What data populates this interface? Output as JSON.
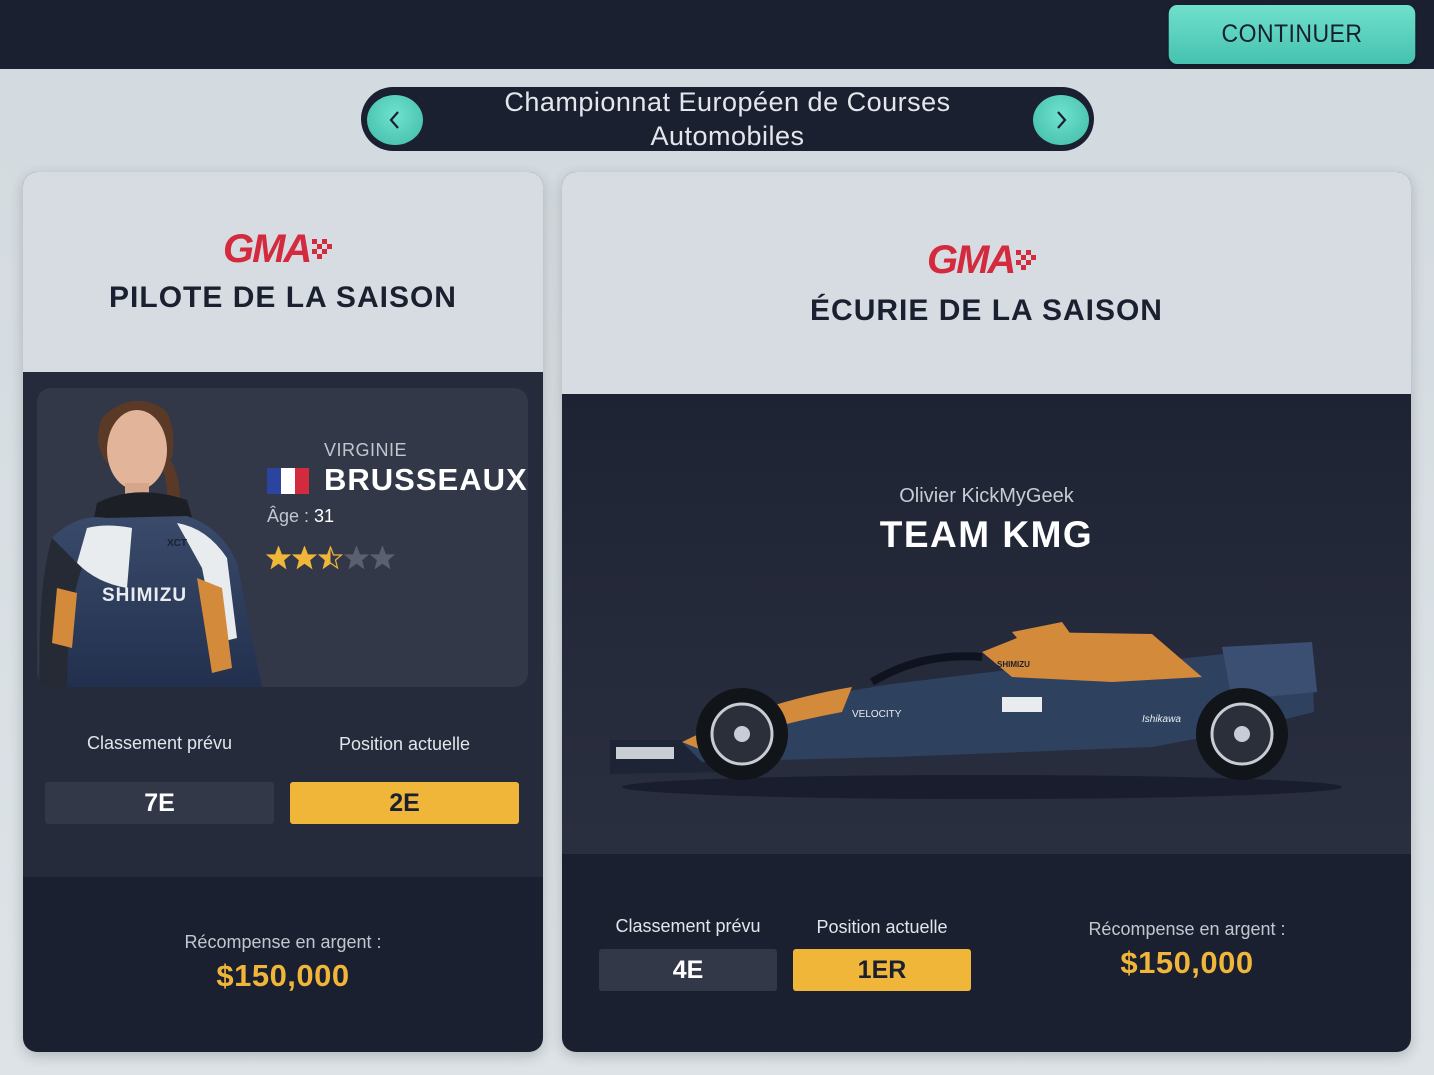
{
  "header": {
    "continue_label": "CONTINUER",
    "championship_title": "Championnat Européen de Courses Automobiles",
    "prev_icon": "chevron-left-icon",
    "next_icon": "chevron-right-icon"
  },
  "driver_award": {
    "logo_text": "GMA",
    "title": "PILOTE DE LA SAISON",
    "first_name": "VIRGINIE",
    "last_name": "BRUSSEAUX",
    "nationality_flag": "france-flag-icon",
    "age_label": "Âge :",
    "age_value": "31",
    "stars": 2.5,
    "stars_max": 5,
    "forecast_label": "Classement prévu",
    "forecast_value": "7E",
    "current_label": "Position actuelle",
    "current_value": "2E",
    "money_label": "Récompense en argent :",
    "money_value": "$150,000"
  },
  "team_award": {
    "logo_text": "GMA",
    "title": "ÉCURIE DE LA SAISON",
    "owner": "Olivier KickMyGeek",
    "team_name": "TEAM KMG",
    "forecast_label": "Classement prévu",
    "forecast_value": "4E",
    "current_label": "Position actuelle",
    "current_value": "1ER",
    "money_label": "Récompense en argent :",
    "money_value": "$150,000"
  },
  "colors": {
    "accent_teal": "#4fcab7",
    "gold": "#f0b63a",
    "dark_navy": "#1b2030",
    "logo_red": "#d42a3d"
  }
}
